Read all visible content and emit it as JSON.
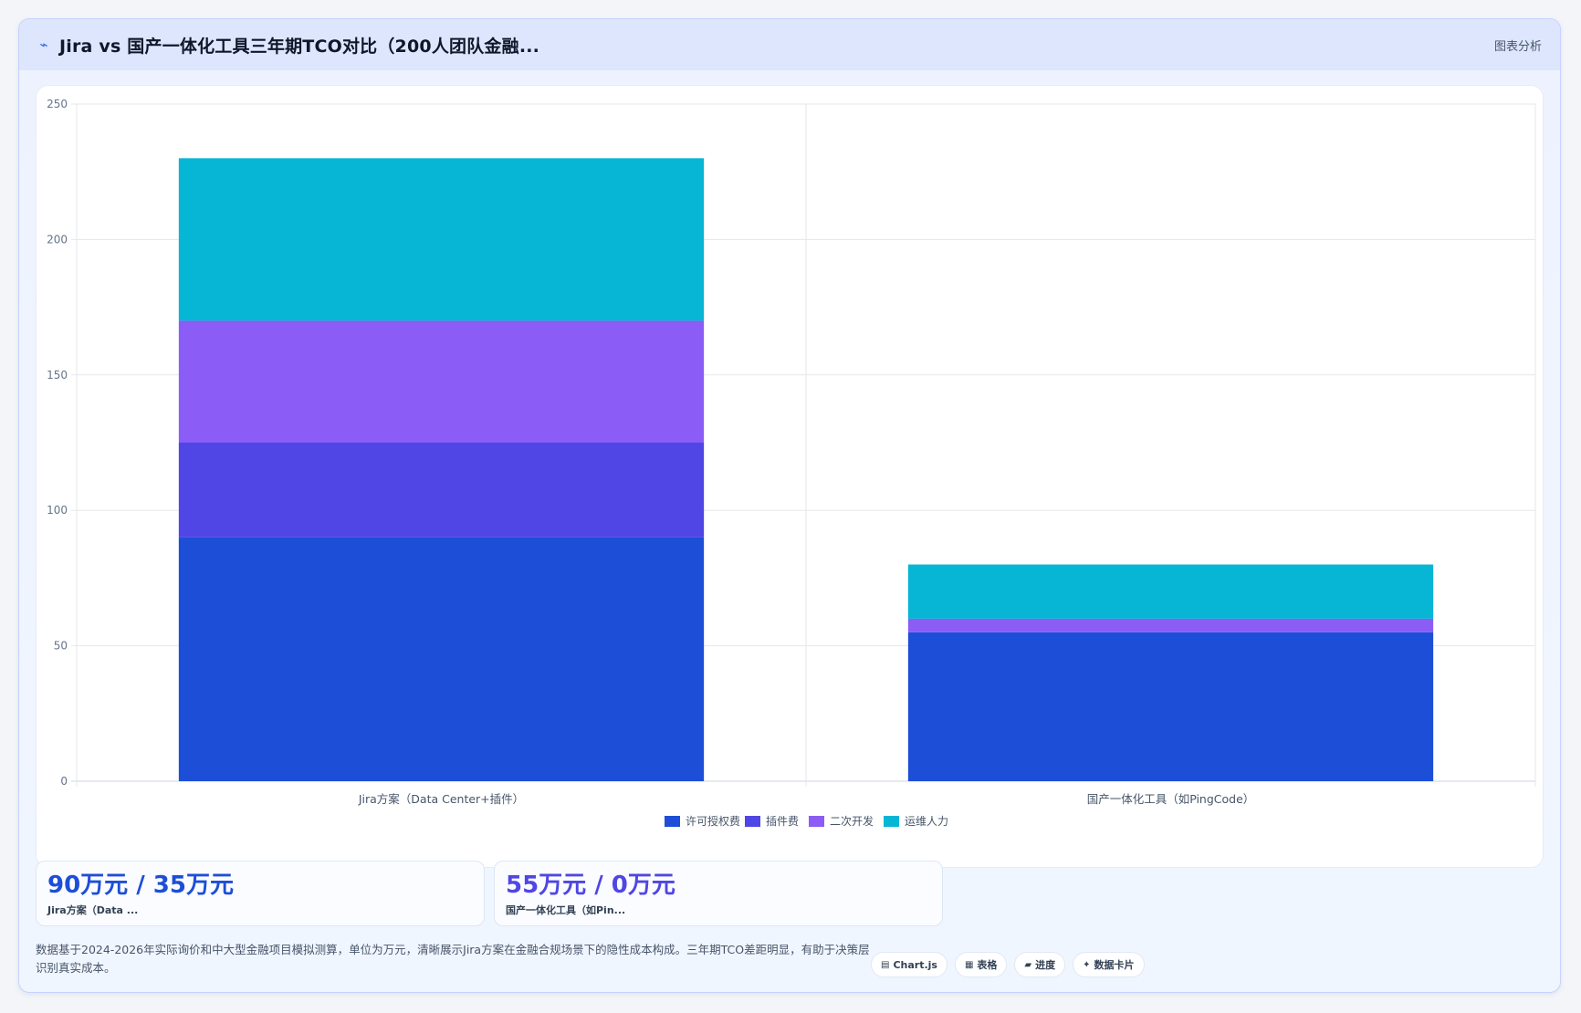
{
  "header": {
    "icon": "chart-line-icon",
    "title": "Jira vs 国产一体化工具三年期TCO对比（200人团队金融...",
    "right_label": "图表分析"
  },
  "chart_data": {
    "type": "bar",
    "stacked": true,
    "categories": [
      "Jira方案（Data Center+插件）",
      "国产一体化工具（如PingCode）"
    ],
    "series": [
      {
        "name": "许可授权费",
        "color": "#1d4ed8",
        "values": [
          90,
          55
        ]
      },
      {
        "name": "插件费",
        "color": "#4f46e5",
        "values": [
          35,
          0
        ]
      },
      {
        "name": "二次开发",
        "color": "#8b5cf6",
        "values": [
          45,
          5
        ]
      },
      {
        "name": "运维人力",
        "color": "#06b6d4",
        "values": [
          60,
          20
        ]
      }
    ],
    "ylim": [
      0,
      250
    ],
    "yticks": [
      0,
      50,
      100,
      150,
      200,
      250
    ],
    "grid": true,
    "legend_position": "bottom"
  },
  "kpis": [
    {
      "value": "90万元 / 35万元",
      "label": "Jira方案（Data ...",
      "color": "#1d4ed8"
    },
    {
      "value": "55万元 / 0万元",
      "label": "国产一体化工具（如Pin...",
      "color": "#4f46e5"
    }
  ],
  "footnote": "数据基于2024-2026年实际询价和中大型金融项目模拟测算，单位为万元，清晰展示Jira方案在金融合规场景下的隐性成本构成。三年期TCO差距明显，有助于决策层识别真实成本。",
  "tools": [
    {
      "icon": "chartjs-icon",
      "label": "Chart.js"
    },
    {
      "icon": "table-icon",
      "label": "表格"
    },
    {
      "icon": "progress-icon",
      "label": "进度"
    },
    {
      "icon": "data-card-icon",
      "label": "数据卡片"
    }
  ]
}
